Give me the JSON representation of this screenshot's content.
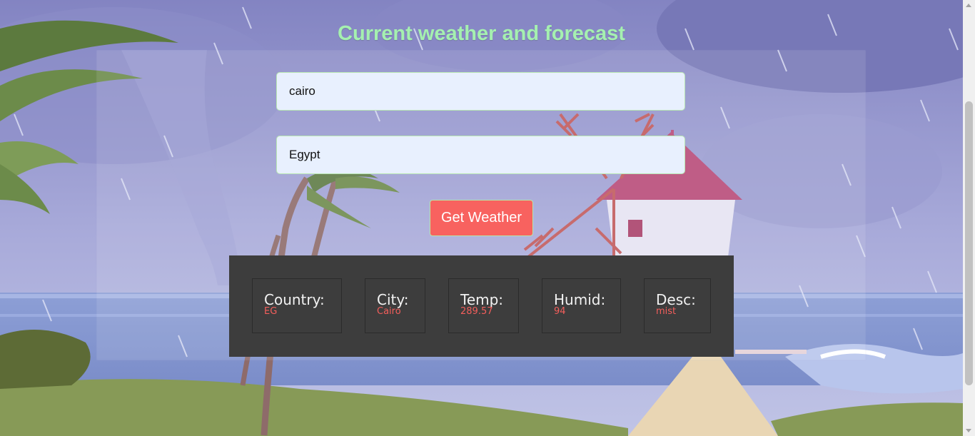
{
  "page": {
    "title": "Current weather and forecast"
  },
  "form": {
    "city_value": "cairo",
    "country_value": "Egypt",
    "submit_label": "Get Weather"
  },
  "results": [
    {
      "label": "Country:",
      "value": "EG"
    },
    {
      "label": "City:",
      "value": "Cairo"
    },
    {
      "label": "Temp:",
      "value": "289.57"
    },
    {
      "label": "Humid:",
      "value": "94"
    },
    {
      "label": "Desc:",
      "value": "mist"
    }
  ],
  "colors": {
    "title": "#a5f0b0",
    "button": "#f8625f",
    "panel": "#3d3d3d",
    "value_text": "#f35e5b",
    "input_bg": "#e8f0fe"
  }
}
